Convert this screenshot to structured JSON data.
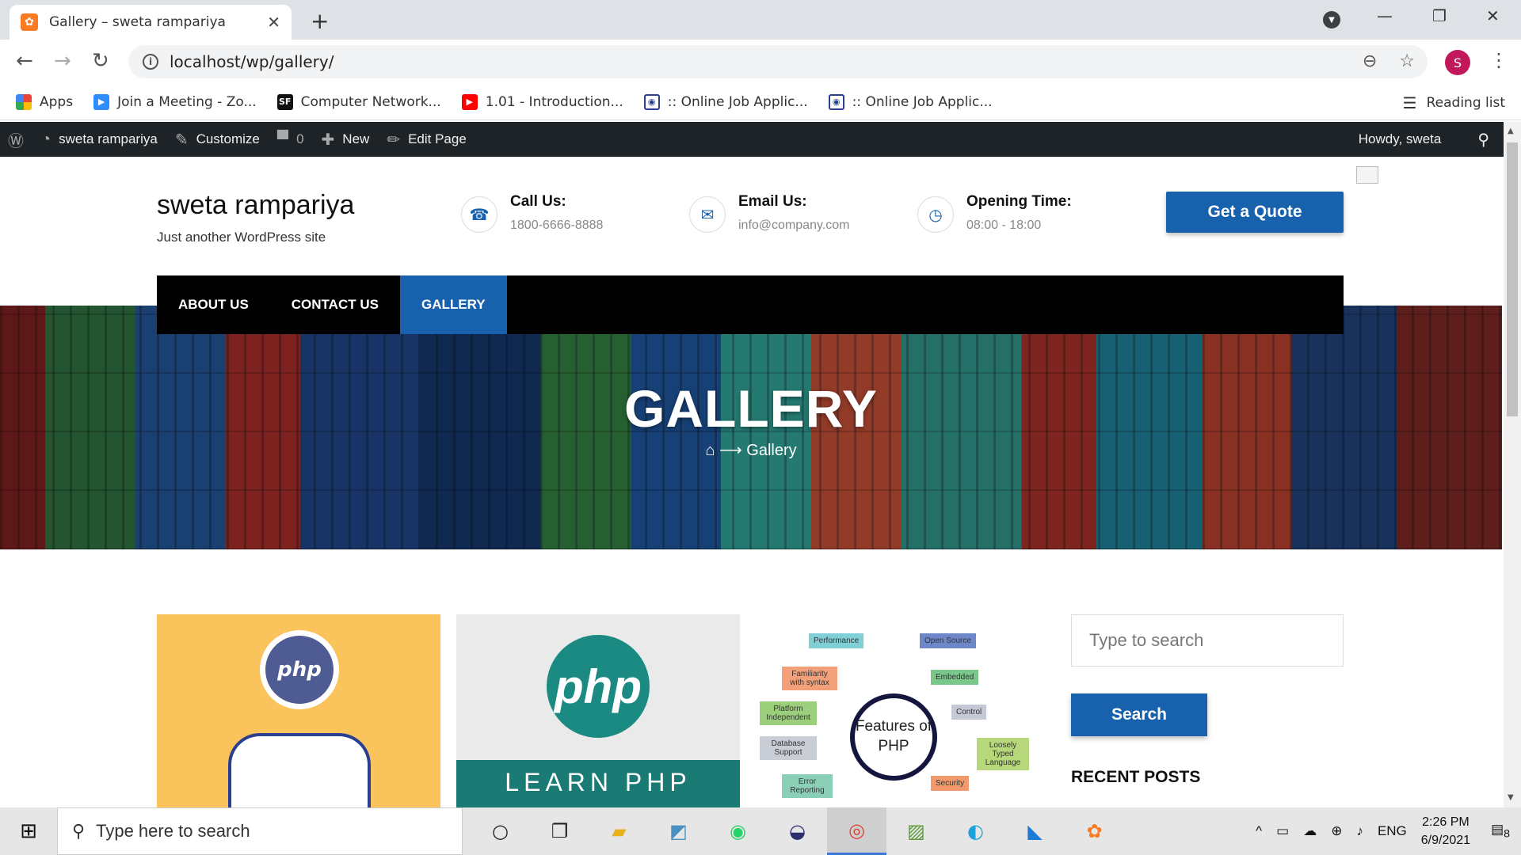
{
  "browser": {
    "tab_title": "Gallery – sweta rampariya",
    "url": "localhost/wp/gallery/",
    "avatar_letter": "S",
    "bookmarks": [
      {
        "label": "Apps"
      },
      {
        "label": "Join a Meeting - Zo..."
      },
      {
        "label": "Computer Network..."
      },
      {
        "label": "1.01 - Introduction..."
      },
      {
        "label": ":: Online Job Applic..."
      },
      {
        "label": ":: Online Job Applic..."
      }
    ],
    "reading_list": "Reading list"
  },
  "adminbar": {
    "site_name": "sweta rampariya",
    "customize": "Customize",
    "comments_count": "0",
    "new": "New",
    "edit_page": "Edit Page",
    "howdy": "Howdy, sweta"
  },
  "site": {
    "title": "sweta rampariya",
    "tagline": "Just another WordPress site",
    "call_label": "Call Us:",
    "call_value": "1800-6666-8888",
    "email_label": "Email Us:",
    "email_value": "info@company.com",
    "hours_label": "Opening Time:",
    "hours_value": "08:00 - 18:00",
    "quote_button": "Get a Quote"
  },
  "nav": {
    "items": [
      {
        "label": "ABOUT US"
      },
      {
        "label": "CONTACT US"
      },
      {
        "label": "GALLERY"
      }
    ]
  },
  "banner": {
    "title": "GALLERY",
    "breadcrumb": "Gallery"
  },
  "gallery": {
    "img1_logo": "php",
    "img2_logo": "php",
    "img2_caption": "LEARN PHP",
    "img3_center": "Features of PHP",
    "img3_features": [
      "Performance",
      "Open Source",
      "Familiarity with syntax",
      "Embedded",
      "Platform Independent",
      "Control",
      "Database Support",
      "Loosely Typed Language",
      "Error Reporting",
      "Security"
    ]
  },
  "sidebar": {
    "search_placeholder": "Type to search",
    "search_button": "Search",
    "recent_posts": "RECENT POSTS"
  },
  "taskbar": {
    "search_placeholder": "Type here to search",
    "lang": "ENG",
    "time": "2:26 PM",
    "date": "6/9/2021",
    "notifications": "8"
  },
  "colors": {
    "accent": "#1862ad",
    "adminbar": "#1d2327",
    "navbar": "#000000"
  }
}
